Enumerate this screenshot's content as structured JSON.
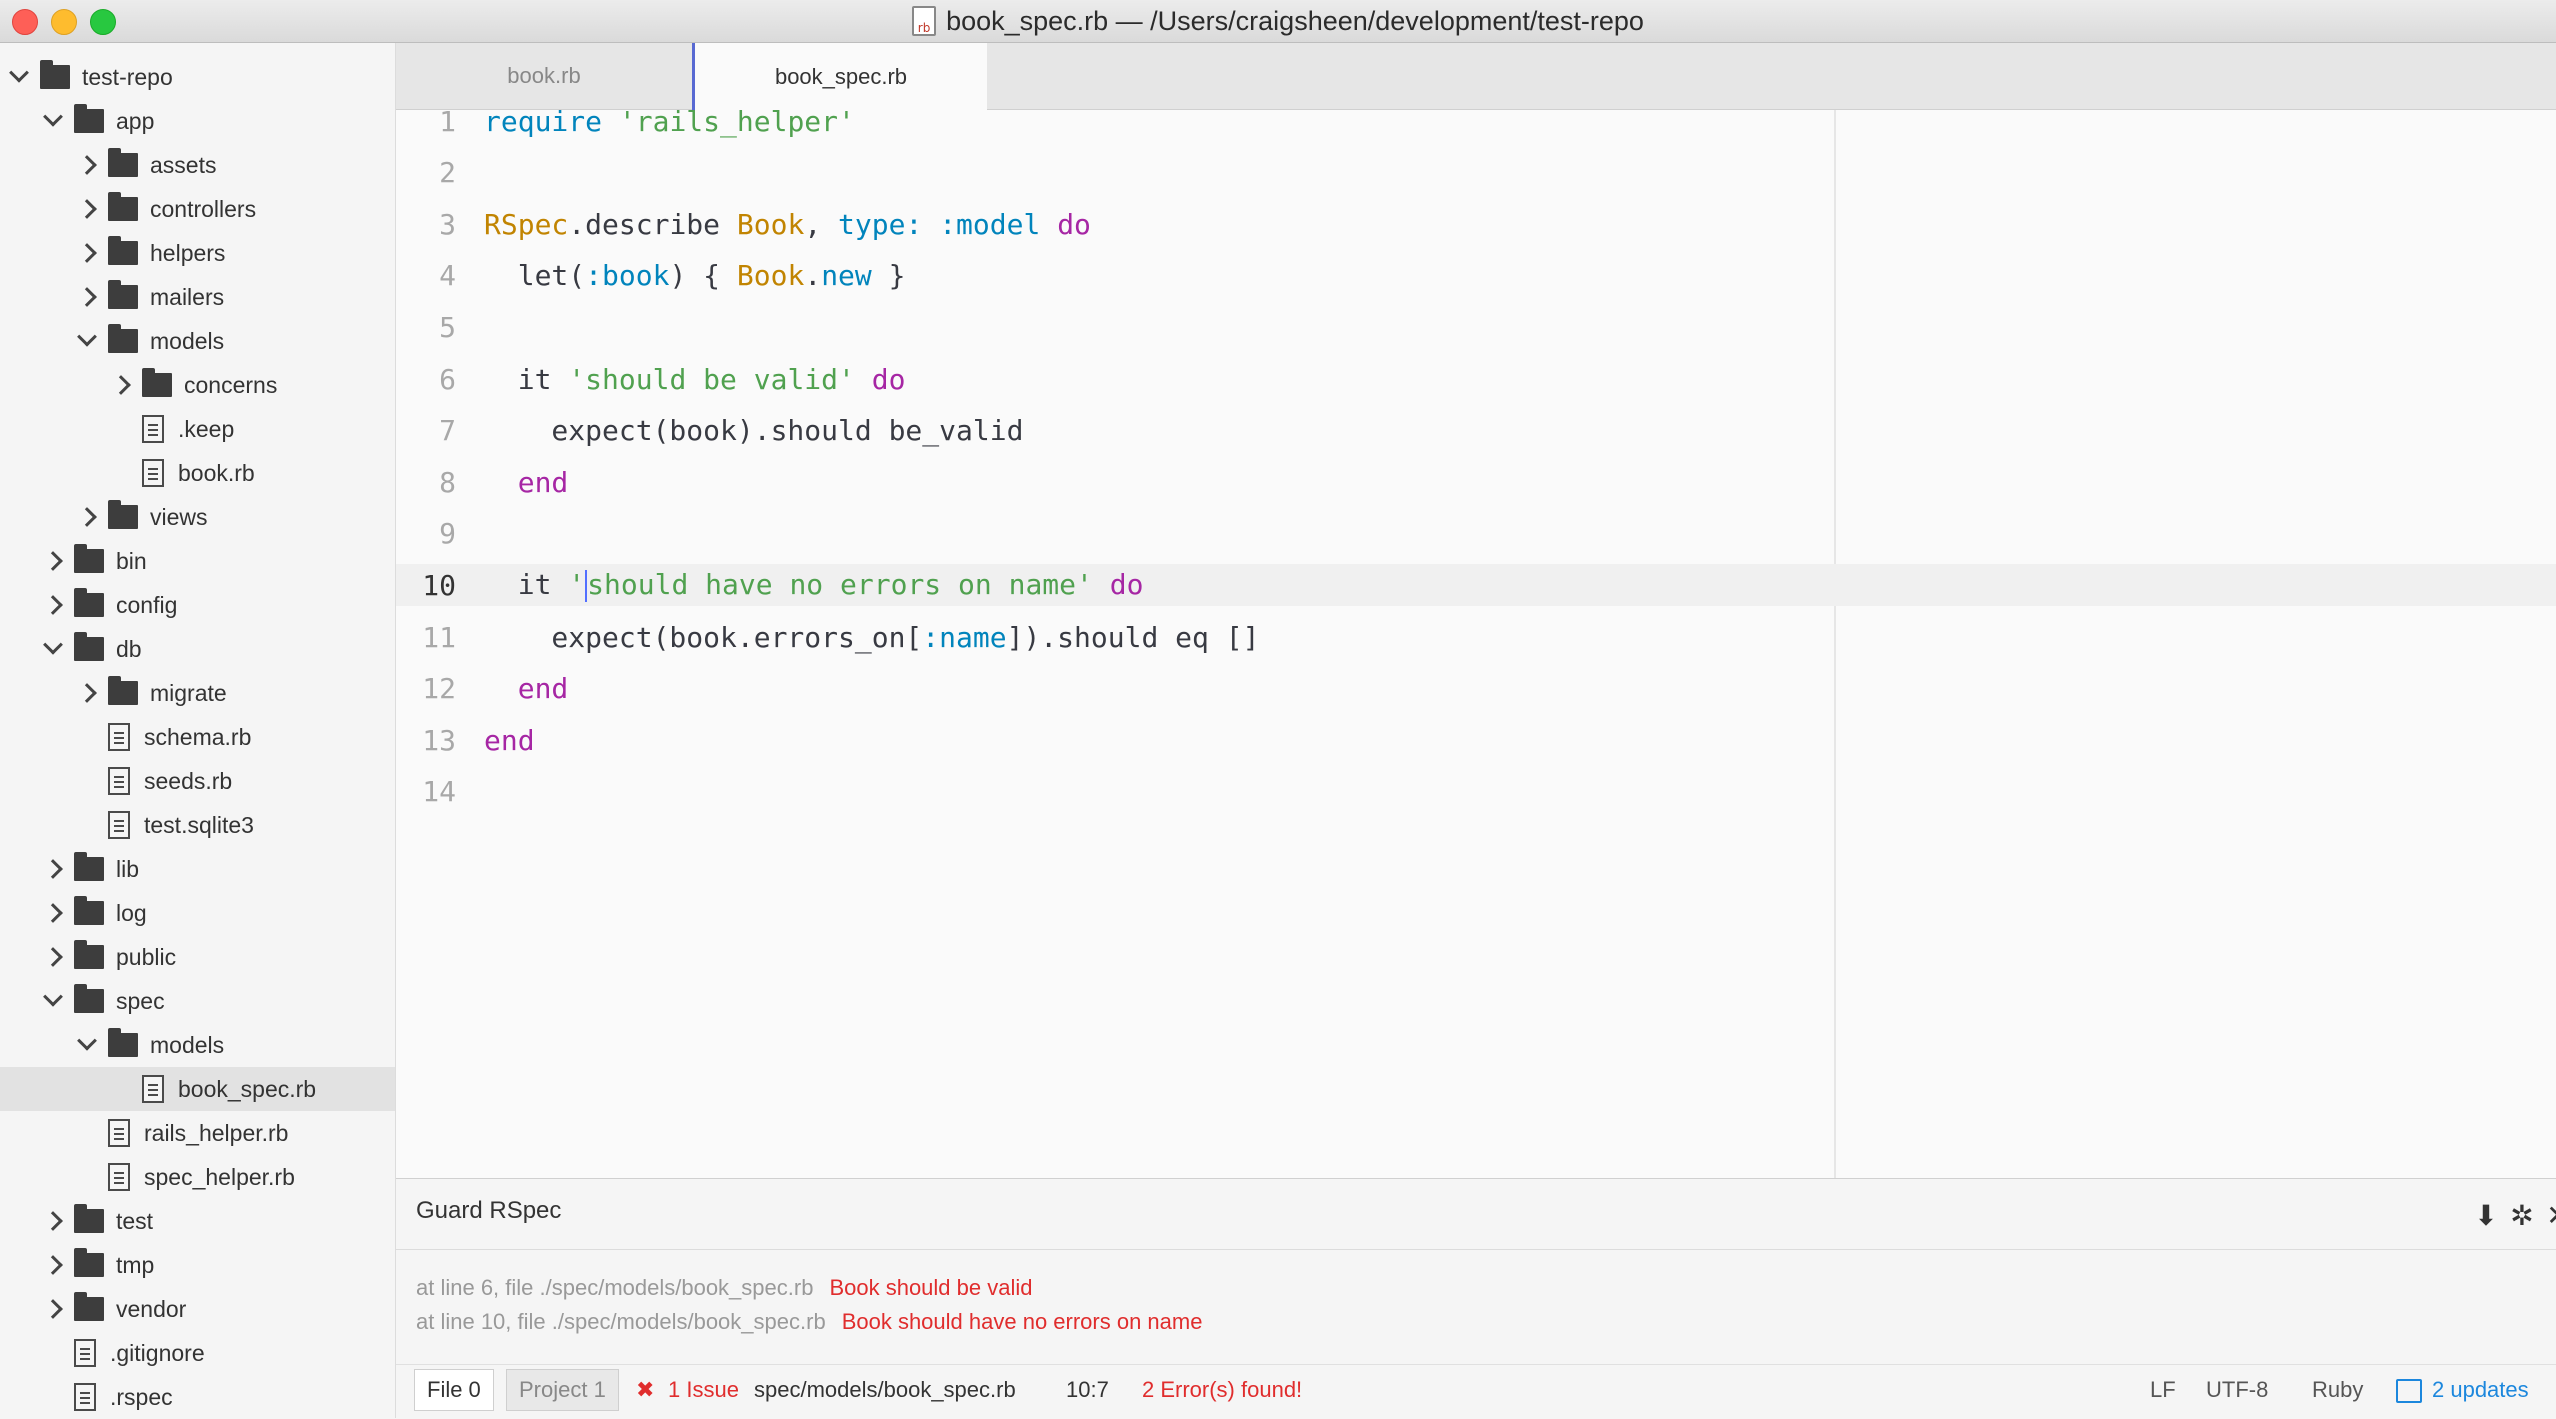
{
  "window": {
    "title": "book_spec.rb — /Users/craigsheen/development/test-repo",
    "file_icon_text": "rb"
  },
  "tree": [
    {
      "label": "test-repo",
      "type": "folder",
      "open": true,
      "depth": 0
    },
    {
      "label": "app",
      "type": "folder",
      "open": true,
      "depth": 1
    },
    {
      "label": "assets",
      "type": "folder",
      "open": false,
      "depth": 2
    },
    {
      "label": "controllers",
      "type": "folder",
      "open": false,
      "depth": 2
    },
    {
      "label": "helpers",
      "type": "folder",
      "open": false,
      "depth": 2
    },
    {
      "label": "mailers",
      "type": "folder",
      "open": false,
      "depth": 2
    },
    {
      "label": "models",
      "type": "folder",
      "open": true,
      "depth": 2
    },
    {
      "label": "concerns",
      "type": "folder",
      "open": false,
      "depth": 3
    },
    {
      "label": ".keep",
      "type": "file",
      "depth": 3
    },
    {
      "label": "book.rb",
      "type": "file",
      "depth": 3
    },
    {
      "label": "views",
      "type": "folder",
      "open": false,
      "depth": 2
    },
    {
      "label": "bin",
      "type": "folder",
      "open": false,
      "depth": 1
    },
    {
      "label": "config",
      "type": "folder",
      "open": false,
      "depth": 1
    },
    {
      "label": "db",
      "type": "folder",
      "open": true,
      "depth": 1
    },
    {
      "label": "migrate",
      "type": "folder",
      "open": false,
      "depth": 2
    },
    {
      "label": "schema.rb",
      "type": "file",
      "depth": 2
    },
    {
      "label": "seeds.rb",
      "type": "file",
      "depth": 2
    },
    {
      "label": "test.sqlite3",
      "type": "file",
      "depth": 2
    },
    {
      "label": "lib",
      "type": "folder",
      "open": false,
      "depth": 1
    },
    {
      "label": "log",
      "type": "folder",
      "open": false,
      "depth": 1
    },
    {
      "label": "public",
      "type": "folder",
      "open": false,
      "depth": 1
    },
    {
      "label": "spec",
      "type": "folder",
      "open": true,
      "depth": 1
    },
    {
      "label": "models",
      "type": "folder",
      "open": true,
      "depth": 2
    },
    {
      "label": "book_spec.rb",
      "type": "file",
      "depth": 3,
      "selected": true
    },
    {
      "label": "rails_helper.rb",
      "type": "file",
      "depth": 2
    },
    {
      "label": "spec_helper.rb",
      "type": "file",
      "depth": 2
    },
    {
      "label": "test",
      "type": "folder",
      "open": false,
      "depth": 1
    },
    {
      "label": "tmp",
      "type": "folder",
      "open": false,
      "depth": 1
    },
    {
      "label": "vendor",
      "type": "folder",
      "open": false,
      "depth": 1
    },
    {
      "label": ".gitignore",
      "type": "file",
      "depth": 1
    },
    {
      "label": ".rspec",
      "type": "file",
      "depth": 1
    }
  ],
  "tabs": [
    {
      "label": "book.rb",
      "active": false
    },
    {
      "label": "book_spec.rb",
      "active": true
    }
  ],
  "editor": {
    "current_line": 10,
    "lines": [
      [
        {
          "t": "require",
          "c": "kw-sym"
        },
        {
          "t": " "
        },
        {
          "t": "'rails_helper'",
          "c": "str"
        }
      ],
      [],
      [
        {
          "t": "RSpec",
          "c": "const"
        },
        {
          "t": ".describe "
        },
        {
          "t": "Book",
          "c": "const"
        },
        {
          "t": ", "
        },
        {
          "t": "type:",
          "c": "sym"
        },
        {
          "t": " "
        },
        {
          "t": ":model",
          "c": "sym"
        },
        {
          "t": " "
        },
        {
          "t": "do",
          "c": "kw"
        }
      ],
      [
        {
          "t": "  let("
        },
        {
          "t": ":book",
          "c": "sym"
        },
        {
          "t": ") { "
        },
        {
          "t": "Book",
          "c": "const"
        },
        {
          "t": "."
        },
        {
          "t": "new",
          "c": "sym"
        },
        {
          "t": " }"
        }
      ],
      [],
      [
        {
          "t": "  it "
        },
        {
          "t": "'should be valid'",
          "c": "str"
        },
        {
          "t": " "
        },
        {
          "t": "do",
          "c": "kw"
        }
      ],
      [
        {
          "t": "    expect(book).should be_valid"
        }
      ],
      [
        {
          "t": "  "
        },
        {
          "t": "end",
          "c": "kw"
        }
      ],
      [],
      [
        {
          "t": "  it "
        },
        {
          "t": "'",
          "c": "str"
        },
        {
          "cursor": true
        },
        {
          "t": "should have no errors on name'",
          "c": "str"
        },
        {
          "t": " "
        },
        {
          "t": "do",
          "c": "kw"
        }
      ],
      [
        {
          "t": "    expect(book.errors_on["
        },
        {
          "t": ":name",
          "c": "sym"
        },
        {
          "t": "]).should eq []"
        }
      ],
      [
        {
          "t": "  "
        },
        {
          "t": "end",
          "c": "kw"
        }
      ],
      [
        {
          "t": "end",
          "c": "kw"
        }
      ],
      []
    ]
  },
  "panel": {
    "title": "Guard RSpec",
    "logs": [
      {
        "location": "at line 6, file ./spec/models/book_spec.rb",
        "message": "Book should be valid"
      },
      {
        "location": "at line 10, file ./spec/models/book_spec.rb",
        "message": "Book should have no errors on name"
      }
    ],
    "buttons": {
      "download": "⬇",
      "settings": "✲",
      "close": "✕"
    }
  },
  "status": {
    "file_tab": "File  0",
    "project_tab": "Project  1",
    "issue_icon": "✖",
    "issues": "1 Issue",
    "path": "spec/models/book_spec.rb",
    "cursor": "10:7",
    "errors": "2 Error(s) found!",
    "line_ending": "LF",
    "encoding": "UTF-8",
    "grammar": "Ruby",
    "updates": "2 updates"
  },
  "colors": {
    "keyword": "#a626a4",
    "string": "#50a14f",
    "constant": "#c18401",
    "symbol": "#0184bc",
    "error": "#e02d2d",
    "accent": "#5869d2"
  }
}
